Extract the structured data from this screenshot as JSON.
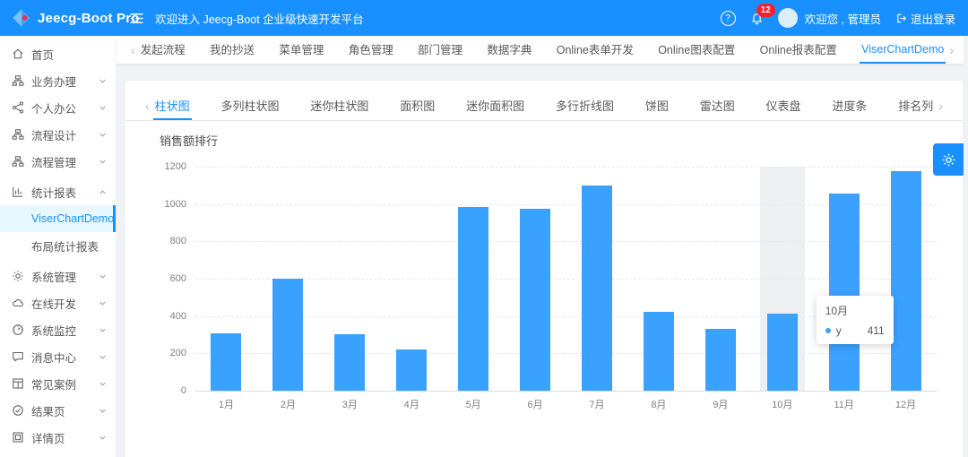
{
  "header": {
    "logo_text": "Jeecg-Boot Pro",
    "welcome": "欢迎进入 Jeecg-Boot 企业级快速开发平台",
    "notification_count": "12",
    "user_greeting": "欢迎您 , 管理员",
    "logout_label": "退出登录"
  },
  "icons": {
    "collapse": "menu-fold",
    "help": "question-circle",
    "notifications": "bell",
    "logout": "logout",
    "settings": "gear",
    "tab_scroll_left": "chevron-left",
    "tab_scroll_right": "chevron-right"
  },
  "sidebar": {
    "items": [
      {
        "label": "首页",
        "icon": "home"
      },
      {
        "label": "业务办理",
        "icon": "cluster",
        "expandable": true
      },
      {
        "label": "个人办公",
        "icon": "share",
        "expandable": true
      },
      {
        "label": "流程设计",
        "icon": "cluster",
        "expandable": true
      },
      {
        "label": "流程管理",
        "icon": "cluster",
        "expandable": true
      },
      {
        "label": "统计报表",
        "icon": "bar-chart",
        "expandable": true,
        "expanded": true
      },
      {
        "label": "ViserChartDemo",
        "child": true,
        "active": true
      },
      {
        "label": "布局统计报表",
        "child": true
      },
      {
        "label": "系统管理",
        "icon": "gear",
        "expandable": true
      },
      {
        "label": "在线开发",
        "icon": "cloud",
        "expandable": true
      },
      {
        "label": "系统监控",
        "icon": "dashboard",
        "expandable": true
      },
      {
        "label": "消息中心",
        "icon": "message",
        "expandable": true
      },
      {
        "label": "常见案例",
        "icon": "layout",
        "expandable": true
      },
      {
        "label": "结果页",
        "icon": "check-circle",
        "expandable": true
      },
      {
        "label": "详情页",
        "icon": "profile",
        "expandable": true
      }
    ]
  },
  "tabbar": {
    "tabs": [
      "发起流程",
      "我的抄送",
      "菜单管理",
      "角色管理",
      "部门管理",
      "数据字典",
      "Online表单开发",
      "Online图表配置",
      "Online报表配置",
      "ViserChartDemo"
    ],
    "active": "ViserChartDemo"
  },
  "chart_page": {
    "tabs": [
      "柱状图",
      "多列柱状图",
      "迷你柱状图",
      "面积图",
      "迷你面积图",
      "多行折线图",
      "饼图",
      "雷达图",
      "仪表盘",
      "进度条",
      "排名列"
    ],
    "active_tab": "柱状图",
    "title": "销售额排行"
  },
  "chart_data": {
    "type": "bar",
    "title": "销售额排行",
    "categories": [
      "1月",
      "2月",
      "3月",
      "4月",
      "5月",
      "6月",
      "7月",
      "8月",
      "9月",
      "10月",
      "11月",
      "12月"
    ],
    "values": [
      305,
      600,
      300,
      220,
      985,
      975,
      1100,
      420,
      330,
      411,
      1055,
      1175
    ],
    "xlabel": "",
    "ylabel": "",
    "ylim": [
      0,
      1200
    ],
    "y_ticks": [
      0,
      200,
      400,
      600,
      800,
      1000,
      1200
    ],
    "grid": "horizontal-dashed",
    "legend": "none",
    "bar_color": "#3aa1ff",
    "tooltip": {
      "title": "10月",
      "series": "y",
      "value": "411",
      "highlight_index": 9
    }
  },
  "colors": {
    "header_bg": "#1890ff",
    "accent": "#1890ff",
    "bar": "#3aa1ff",
    "badge": "#f5222d",
    "active_menu_bg": "#e6f7ff",
    "content_bg": "#f0f2f5"
  }
}
